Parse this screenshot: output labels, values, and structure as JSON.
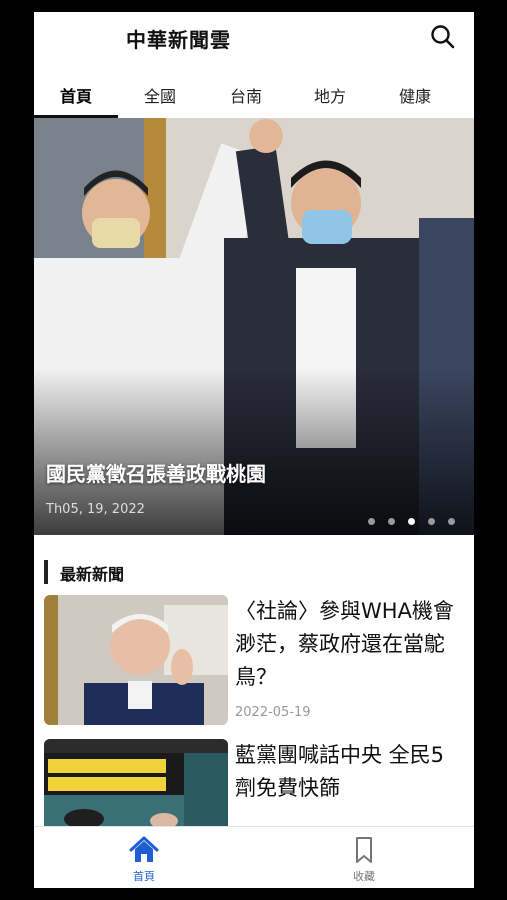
{
  "header": {
    "title": "中華新聞雲",
    "search_icon": "search-icon"
  },
  "tabs": [
    {
      "label": "首頁",
      "active": true
    },
    {
      "label": "全國",
      "active": false
    },
    {
      "label": "台南",
      "active": false
    },
    {
      "label": "地方",
      "active": false
    },
    {
      "label": "健康",
      "active": false
    }
  ],
  "hero": {
    "title": "國民黨徵召張善政戰桃園",
    "date": "Th05, 19, 2022",
    "slide_count": 5,
    "active_slide": 3
  },
  "latest": {
    "section_title": "最新新聞",
    "items": [
      {
        "title": "〈社論〉參與WHA機會渺茫，蔡政府還在當鴕鳥？",
        "date": "2022-05-19"
      },
      {
        "title": "藍黨團喊話中央 全民5劑免費快篩",
        "date": ""
      }
    ]
  },
  "bottom_nav": [
    {
      "label": "首頁",
      "icon": "home-icon",
      "active": true
    },
    {
      "label": "收藏",
      "icon": "bookmark-icon",
      "active": false
    }
  ],
  "colors": {
    "accent": "#1f5fd6",
    "inactive": "#777777"
  }
}
